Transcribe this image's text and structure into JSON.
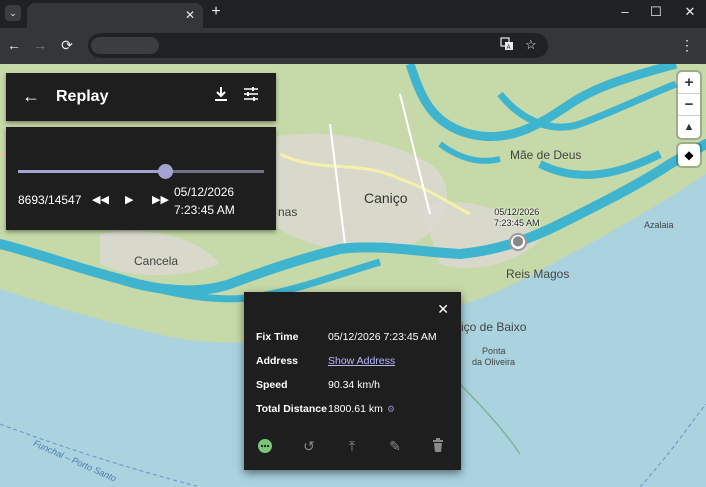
{
  "browser": {
    "tab_close": "✕",
    "new_tab": "+",
    "minimize": "–",
    "maximize": "☐",
    "close": "✕",
    "back": "←",
    "forward": "→",
    "reload": "⟳",
    "translate_icon": "translate-icon",
    "star_icon": "☆",
    "menu": "⋮"
  },
  "map": {
    "labels": {
      "canico": "Caniço",
      "mae_de_deus": "Mãe de Deus",
      "cancela": "Cancela",
      "reis_magos": "Reis Magos",
      "canico_de_baixo": "içо de Baixo",
      "ponta_oliveira_1": "Ponta",
      "ponta_oliveira_2": "da Oliveira",
      "azalaia": "Azalaia",
      "funchal_porto_santo": "Funchal – Porto Santo",
      "nas": "nas"
    },
    "zoom_in": "+",
    "zoom_out": "−",
    "compass": "▲",
    "marker_date": "05/12/2026",
    "marker_time": "7:23:45 AM",
    "colors": {
      "track": "#3fb4cf",
      "sea": "#aad3df",
      "land": "#c6d9a8"
    }
  },
  "replay": {
    "title": "Replay",
    "progress_fraction": 0.598,
    "counter": "8693/14547",
    "date": "05/12/2026",
    "time": "7:23:45 AM"
  },
  "popup": {
    "rows": [
      {
        "key": "Fix Time",
        "value": "05/12/2026 7:23:45 AM"
      },
      {
        "key": "Address",
        "value": "Show Address"
      },
      {
        "key": "Speed",
        "value": "90.34 km/h"
      },
      {
        "key": "Total Distance",
        "value": "1800.61 km"
      }
    ]
  }
}
